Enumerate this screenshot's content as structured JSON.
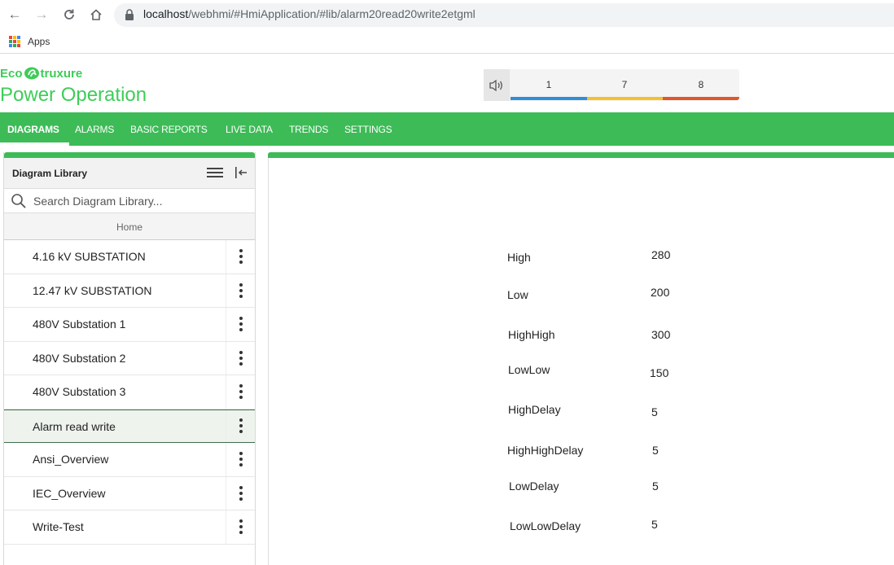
{
  "browser": {
    "url_host": "localhost",
    "url_path": "/webhmi/#HmiApplication/#lib/alarm20read20write2etgml",
    "bookmarks_apps": "Apps"
  },
  "header": {
    "logo_eco": "Eco",
    "logo_truxure": "truxure",
    "product_name": "Power Operation",
    "alarm_counts": {
      "high": "1",
      "medium": "7",
      "low": "8"
    },
    "alarm_colors": {
      "high": "#2f8fd8",
      "medium": "#f2c12e",
      "low": "#e0572a"
    }
  },
  "nav": {
    "diagrams": "DIAGRAMS",
    "alarms": "ALARMS",
    "basic_reports": "BASIC REPORTS",
    "live_data": "LIVE DATA",
    "trends": "TRENDS",
    "settings": "SETTINGS"
  },
  "library": {
    "title": "Diagram Library",
    "search_placeholder": "Search Diagram Library...",
    "home": "Home",
    "items": [
      {
        "label": "4.16 kV SUBSTATION"
      },
      {
        "label": "12.47 kV SUBSTATION"
      },
      {
        "label": "480V Substation 1"
      },
      {
        "label": "480V Substation 2"
      },
      {
        "label": "480V Substation 3"
      },
      {
        "label": "Alarm read write",
        "selected": true
      },
      {
        "label": "Ansi_Overview"
      },
      {
        "label": "IEC_Overview"
      },
      {
        "label": "Write-Test"
      }
    ]
  },
  "diagram": {
    "params": [
      {
        "label": "High",
        "value": "280"
      },
      {
        "label": "Low",
        "value": "200"
      },
      {
        "label": "HighHigh",
        "value": "300"
      },
      {
        "label": "LowLow",
        "value": "150"
      },
      {
        "label": "HighDelay",
        "value": "5"
      },
      {
        "label": "HighHighDelay",
        "value": "5"
      },
      {
        "label": "LowDelay",
        "value": "5"
      },
      {
        "label": "LowLowDelay",
        "value": "5"
      }
    ]
  }
}
